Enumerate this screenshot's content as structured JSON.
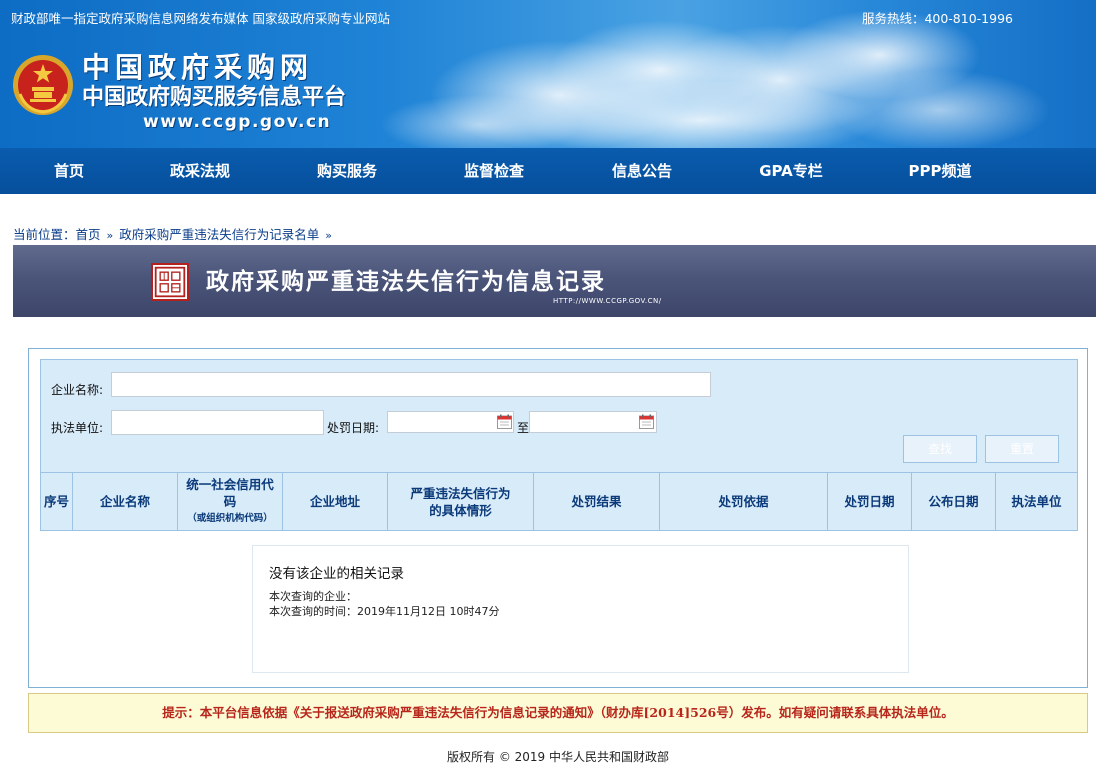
{
  "topbar": {
    "left_text": "财政部唯一指定政府采购信息网络发布媒体  国家级政府采购专业网站",
    "right_text": "服务热线：400-810-1996"
  },
  "header": {
    "title": "中国政府采购网",
    "subtitle": "中国政府购买服务信息平台",
    "url": "www.ccgp.gov.cn"
  },
  "nav": {
    "items": [
      {
        "label": "首页"
      },
      {
        "label": "政采法规"
      },
      {
        "label": "购买服务"
      },
      {
        "label": "监督检查"
      },
      {
        "label": "信息公告"
      },
      {
        "label": "GPA专栏"
      },
      {
        "label": "PPP频道"
      }
    ]
  },
  "breadcrumb": {
    "prefix": "当前位置：",
    "home": "首页",
    "sep": "»",
    "current": "政府采购严重违法失信行为记录名单"
  },
  "banner": {
    "title": "政府采购严重违法失信行为信息记录",
    "url": "HTTP://WWW.CCGP.GOV.CN/"
  },
  "search": {
    "company_label": "企业名称:",
    "company_value": "",
    "unit_label": "执法单位:",
    "unit_value": "",
    "date_label": "处罚日期:",
    "date_from": "",
    "date_to": "",
    "date_sep": "至",
    "search_button": "查找",
    "reset_button": "重置"
  },
  "table": {
    "columns": [
      {
        "label": "序号"
      },
      {
        "label": "企业名称"
      },
      {
        "label": "统一社会信用代码",
        "note": "（或组织机构代码）"
      },
      {
        "label": "企业地址"
      },
      {
        "label": "严重违法失信行为的具体情形"
      },
      {
        "label": "处罚结果"
      },
      {
        "label": "处罚依据"
      },
      {
        "label": "处罚日期"
      },
      {
        "label": "公布日期"
      },
      {
        "label": "执法单位"
      }
    ]
  },
  "result": {
    "message": "没有该企业的相关记录",
    "query_company_label": "本次查询的企业：",
    "query_time_label": "本次查询的时间：",
    "query_time_value": "2019年11月12日  10时47分"
  },
  "notice": {
    "text": "提示：本平台信息依据《关于报送政府采购严重违法失信行为信息记录的通知》（财办库[2014]526号）发布。如有疑问请联系具体执法单位。"
  },
  "footer": {
    "text": "版权所有 © 2019 中华人民共和国财政部"
  }
}
